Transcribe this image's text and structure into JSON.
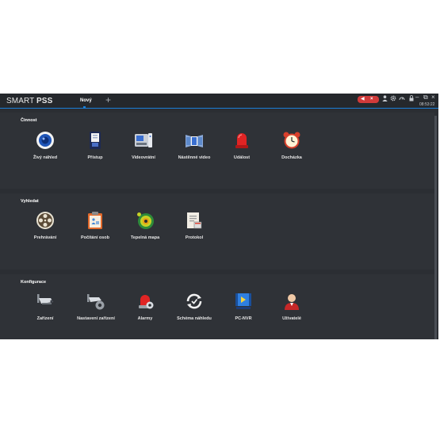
{
  "app": {
    "logo_light": "SMART ",
    "logo_bold": "PSS",
    "tab_label": "Nový",
    "add_tab": "+",
    "clock": "08:53:22",
    "header_icons": [
      "speaker-icon",
      "close-icon",
      "user-icon",
      "gear-icon",
      "gauge-icon",
      "lock-icon"
    ],
    "window_buttons": [
      "minimize-icon",
      "restore-icon",
      "close-icon"
    ],
    "accent_color": "#1a7fd8",
    "rec_color": "#d13a3a"
  },
  "sections": [
    {
      "title": "Činnost",
      "items": [
        {
          "label": "Živý náhled",
          "icon": "live-view-icon"
        },
        {
          "label": "Přístup",
          "icon": "access-icon"
        },
        {
          "label": "Videovrátní",
          "icon": "video-intercom-icon"
        },
        {
          "label": "Nástěnné video",
          "icon": "video-wall-icon"
        },
        {
          "label": "Událost",
          "icon": "event-siren-icon"
        },
        {
          "label": "Docházka",
          "icon": "alarm-clock-icon"
        }
      ]
    },
    {
      "title": "Vyhledat",
      "items": [
        {
          "label": "Prehrávání",
          "icon": "playback-reel-icon"
        },
        {
          "label": "Počítání osob",
          "icon": "people-counting-icon"
        },
        {
          "label": "Tepelná mapa",
          "icon": "heat-map-icon"
        },
        {
          "label": "Protokol",
          "icon": "log-icon"
        }
      ]
    },
    {
      "title": "Konfigurace",
      "items": [
        {
          "label": "Zařízení",
          "icon": "device-camera-icon"
        },
        {
          "label": "Nastavení zařízení",
          "icon": "device-settings-icon"
        },
        {
          "label": "Alarmy",
          "icon": "alarm-siren-icon"
        },
        {
          "label": "Schéma náhledu",
          "icon": "tour-refresh-icon"
        },
        {
          "label": "PC-NVR",
          "icon": "pc-nvr-icon"
        },
        {
          "label": "Uživatelé",
          "icon": "user-icon"
        }
      ]
    }
  ]
}
